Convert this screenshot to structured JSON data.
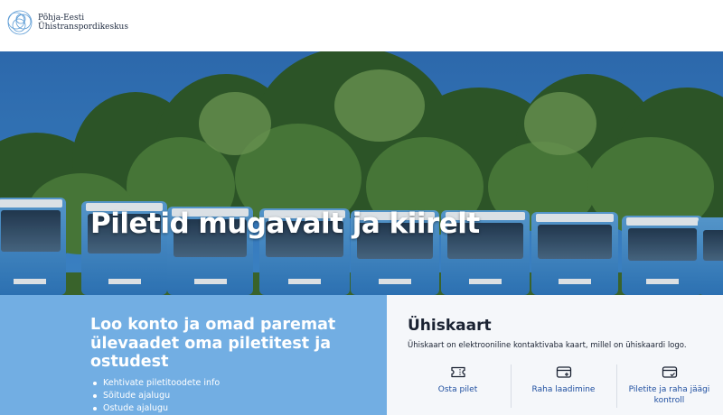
{
  "header": {
    "logo_line1": "Põhja-Eesti",
    "logo_line2": "Ühistranspordikeskus",
    "logo_icon": "concentric-circles-logo"
  },
  "hero": {
    "title": "Piletid mugavalt ja kiirelt",
    "background": "row-of-blue-buses-in-front-of-trees"
  },
  "promo": {
    "title": "Loo konto ja omad paremat ülevaadet oma piletitest ja ostudest",
    "bullets": [
      "Kehtivate piletitoodete info",
      "Sõitude ajalugu",
      "Ostude ajalugu"
    ]
  },
  "card": {
    "title": "Ühiskaart",
    "description": "Ühiskaart on elektrooniline kontaktivaba kaart, millel on ühiskaardi logo.",
    "actions": [
      {
        "label": "Osta pilet",
        "icon": "ticket-icon"
      },
      {
        "label": "Raha laadimine",
        "icon": "card-plus-icon"
      },
      {
        "label": "Piletite ja raha jäägi kontroll",
        "icon": "card-check-icon"
      }
    ]
  },
  "colors": {
    "promo_bg": "#72aee3",
    "card_bg": "#f5f7fa",
    "link": "#1f4fa0",
    "heading": "#1a2232"
  }
}
